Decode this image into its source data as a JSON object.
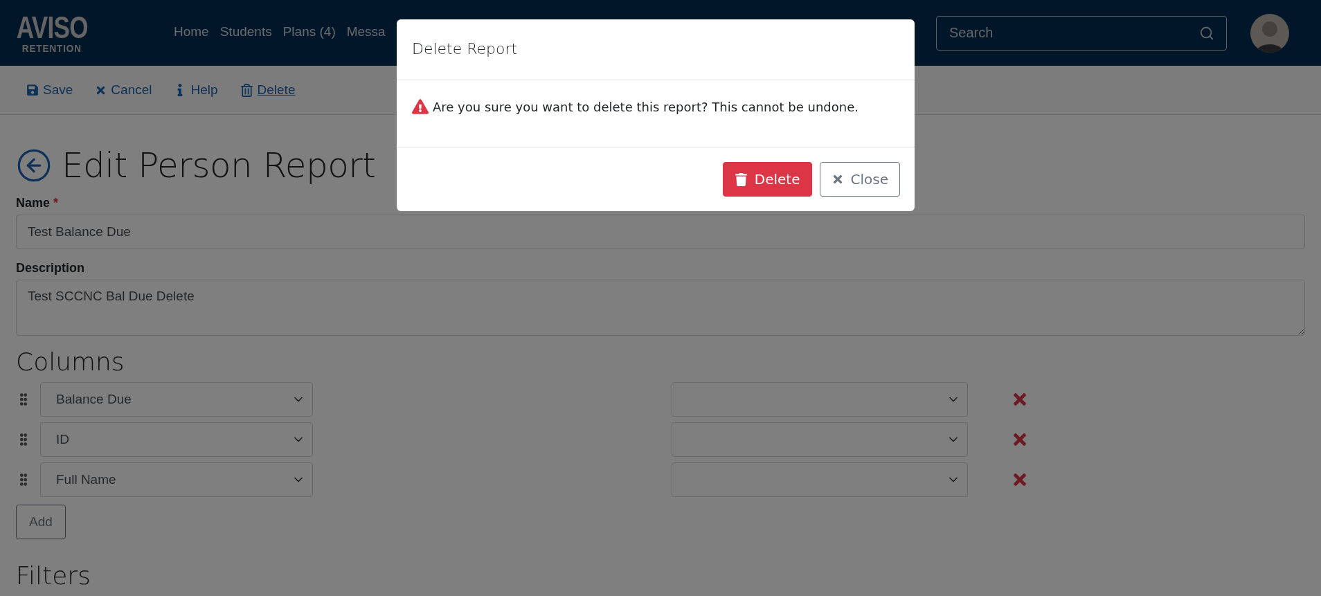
{
  "header": {
    "logo": {
      "line1": "AVISO",
      "line2": "RETENTION"
    },
    "nav": [
      {
        "label": "Home"
      },
      {
        "label": "Students"
      },
      {
        "label": "Plans (4)"
      },
      {
        "label": "Messa"
      }
    ],
    "search": {
      "placeholder": "Search"
    }
  },
  "toolbar": [
    {
      "kind": "save",
      "label": "Save",
      "underlined": false
    },
    {
      "kind": "cancel",
      "label": "Cancel",
      "underlined": false
    },
    {
      "kind": "help",
      "label": "Help",
      "underlined": false
    },
    {
      "kind": "delete",
      "label": "Delete",
      "underlined": true
    }
  ],
  "page": {
    "title": "Edit Person Report",
    "fields": [
      {
        "kind": "input",
        "label": "Name",
        "mark": "*",
        "value": "Test Balance Due"
      },
      {
        "kind": "textarea",
        "label": "Description",
        "value": "Test SCCNC Bal Due Delete"
      }
    ],
    "columns": {
      "heading": "Columns",
      "rows": [
        {
          "field": "Balance Due"
        },
        {
          "field": "ID"
        },
        {
          "field": "Full Name"
        }
      ],
      "add_button": "Add"
    },
    "filters_heading": "Filters"
  },
  "modal": {
    "title": "Delete Report",
    "message": "Are you sure you want to delete this report? This cannot be undone.",
    "buttons": [
      {
        "kind": "danger",
        "label": "Delete"
      },
      {
        "kind": "secondary",
        "label": "Close"
      }
    ]
  }
}
